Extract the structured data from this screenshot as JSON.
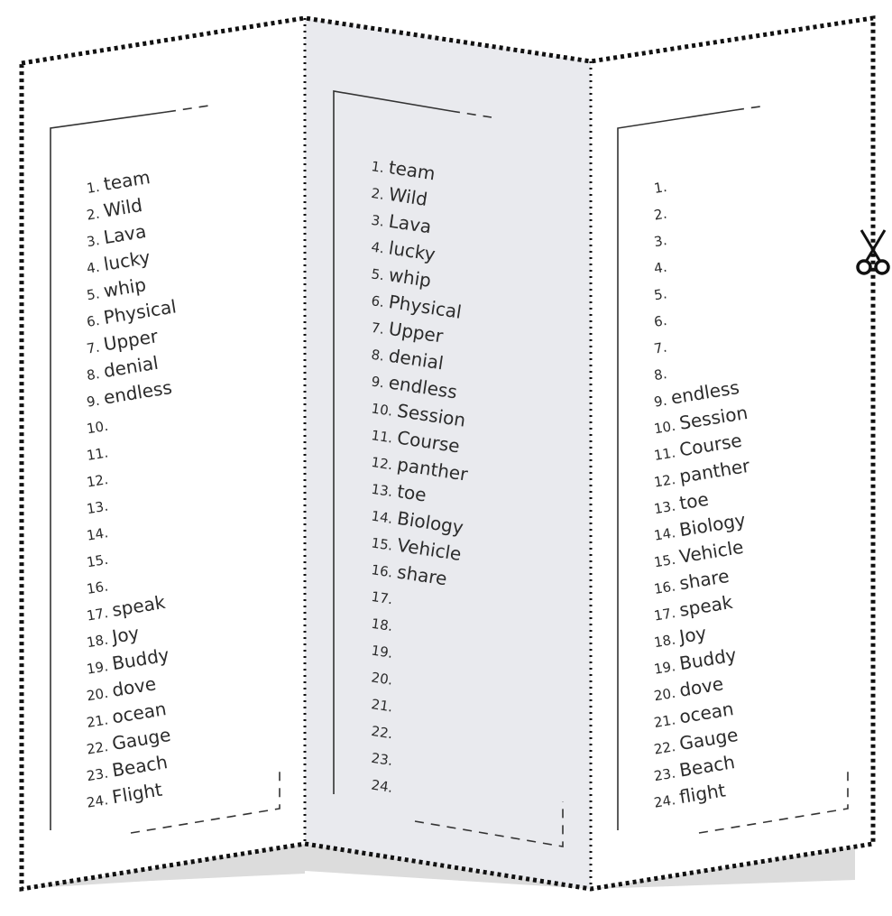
{
  "figure": {
    "description": "Tri-fold pamphlet with numbered word lists on each panel",
    "colors": {
      "outline": "#111111",
      "middle_panel_fill": "#e9eaee",
      "side_panel_fill": "#ffffff",
      "shadow": "#dcdcdc",
      "text": "#2b2b2b"
    },
    "cut_icon": "scissors-icon"
  },
  "panels": [
    {
      "name": "left",
      "items": [
        {
          "n": "1.",
          "w": "team"
        },
        {
          "n": "2.",
          "w": "Wild"
        },
        {
          "n": "3.",
          "w": "Lava"
        },
        {
          "n": "4.",
          "w": "lucky"
        },
        {
          "n": "5.",
          "w": "whip"
        },
        {
          "n": "6.",
          "w": "Physical"
        },
        {
          "n": "7.",
          "w": "Upper"
        },
        {
          "n": "8.",
          "w": "denial"
        },
        {
          "n": "9.",
          "w": "endless"
        },
        {
          "n": "10.",
          "w": ""
        },
        {
          "n": "11.",
          "w": ""
        },
        {
          "n": "12.",
          "w": ""
        },
        {
          "n": "13.",
          "w": ""
        },
        {
          "n": "14.",
          "w": ""
        },
        {
          "n": "15.",
          "w": ""
        },
        {
          "n": "16.",
          "w": ""
        },
        {
          "n": "17.",
          "w": "speak"
        },
        {
          "n": "18.",
          "w": "Joy"
        },
        {
          "n": "19.",
          "w": "Buddy"
        },
        {
          "n": "20.",
          "w": "dove"
        },
        {
          "n": "21.",
          "w": "ocean"
        },
        {
          "n": "22.",
          "w": "Gauge"
        },
        {
          "n": "23.",
          "w": "Beach"
        },
        {
          "n": "24.",
          "w": "Flight"
        }
      ]
    },
    {
      "name": "middle",
      "items": [
        {
          "n": "1.",
          "w": "team"
        },
        {
          "n": "2.",
          "w": "Wild"
        },
        {
          "n": "3.",
          "w": "Lava"
        },
        {
          "n": "4.",
          "w": "lucky"
        },
        {
          "n": "5.",
          "w": "whip"
        },
        {
          "n": "6.",
          "w": "Physical"
        },
        {
          "n": "7.",
          "w": "Upper"
        },
        {
          "n": "8.",
          "w": "denial"
        },
        {
          "n": "9.",
          "w": "endless"
        },
        {
          "n": "10.",
          "w": "Session"
        },
        {
          "n": "11.",
          "w": "Course"
        },
        {
          "n": "12.",
          "w": "panther"
        },
        {
          "n": "13.",
          "w": "toe"
        },
        {
          "n": "14.",
          "w": "Biology"
        },
        {
          "n": "15.",
          "w": "Vehicle"
        },
        {
          "n": "16.",
          "w": "share"
        },
        {
          "n": "17.",
          "w": ""
        },
        {
          "n": "18.",
          "w": ""
        },
        {
          "n": "19.",
          "w": ""
        },
        {
          "n": "20.",
          "w": ""
        },
        {
          "n": "21.",
          "w": ""
        },
        {
          "n": "22.",
          "w": ""
        },
        {
          "n": "23.",
          "w": ""
        },
        {
          "n": "24.",
          "w": ""
        }
      ]
    },
    {
      "name": "right",
      "items": [
        {
          "n": "1.",
          "w": ""
        },
        {
          "n": "2.",
          "w": ""
        },
        {
          "n": "3.",
          "w": ""
        },
        {
          "n": "4.",
          "w": ""
        },
        {
          "n": "5.",
          "w": ""
        },
        {
          "n": "6.",
          "w": ""
        },
        {
          "n": "7.",
          "w": ""
        },
        {
          "n": "8.",
          "w": ""
        },
        {
          "n": "9.",
          "w": "endless"
        },
        {
          "n": "10.",
          "w": "Session"
        },
        {
          "n": "11.",
          "w": "Course"
        },
        {
          "n": "12.",
          "w": "panther"
        },
        {
          "n": "13.",
          "w": "toe"
        },
        {
          "n": "14.",
          "w": "Biology"
        },
        {
          "n": "15.",
          "w": "Vehicle"
        },
        {
          "n": "16.",
          "w": "share"
        },
        {
          "n": "17.",
          "w": "speak"
        },
        {
          "n": "18.",
          "w": "Joy"
        },
        {
          "n": "19.",
          "w": "Buddy"
        },
        {
          "n": "20.",
          "w": "dove"
        },
        {
          "n": "21.",
          "w": "ocean"
        },
        {
          "n": "22.",
          "w": "Gauge"
        },
        {
          "n": "23.",
          "w": "Beach"
        },
        {
          "n": "24.",
          "w": "flight"
        }
      ]
    }
  ]
}
